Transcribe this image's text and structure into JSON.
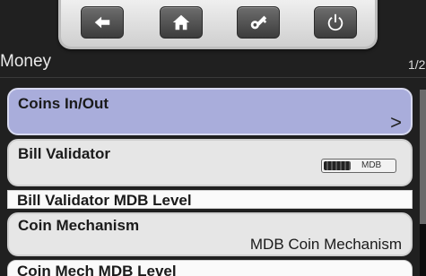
{
  "header": {
    "title": "Money",
    "page_indicator": "1/2"
  },
  "toolbar": {
    "buttons": [
      {
        "icon": "back-arrow-icon"
      },
      {
        "icon": "home-icon"
      },
      {
        "icon": "key-icon"
      },
      {
        "icon": "power-icon"
      }
    ]
  },
  "menu": {
    "coins": {
      "label": "Coins In/Out",
      "chevron": ">"
    },
    "bill_validator": {
      "label": "Bill Validator",
      "toggle_value": "MDB"
    },
    "bill_validator_level": {
      "label": "Bill Validator MDB Level"
    },
    "coin_mechanism": {
      "label": "Coin Mechanism",
      "value": "MDB Coin Mechanism"
    },
    "coin_mech_level": {
      "label": "Coin Mech MDB Level"
    }
  },
  "colors": {
    "selected_item": "#a9addb",
    "item": "#e6e6e6",
    "background": "#202020"
  }
}
